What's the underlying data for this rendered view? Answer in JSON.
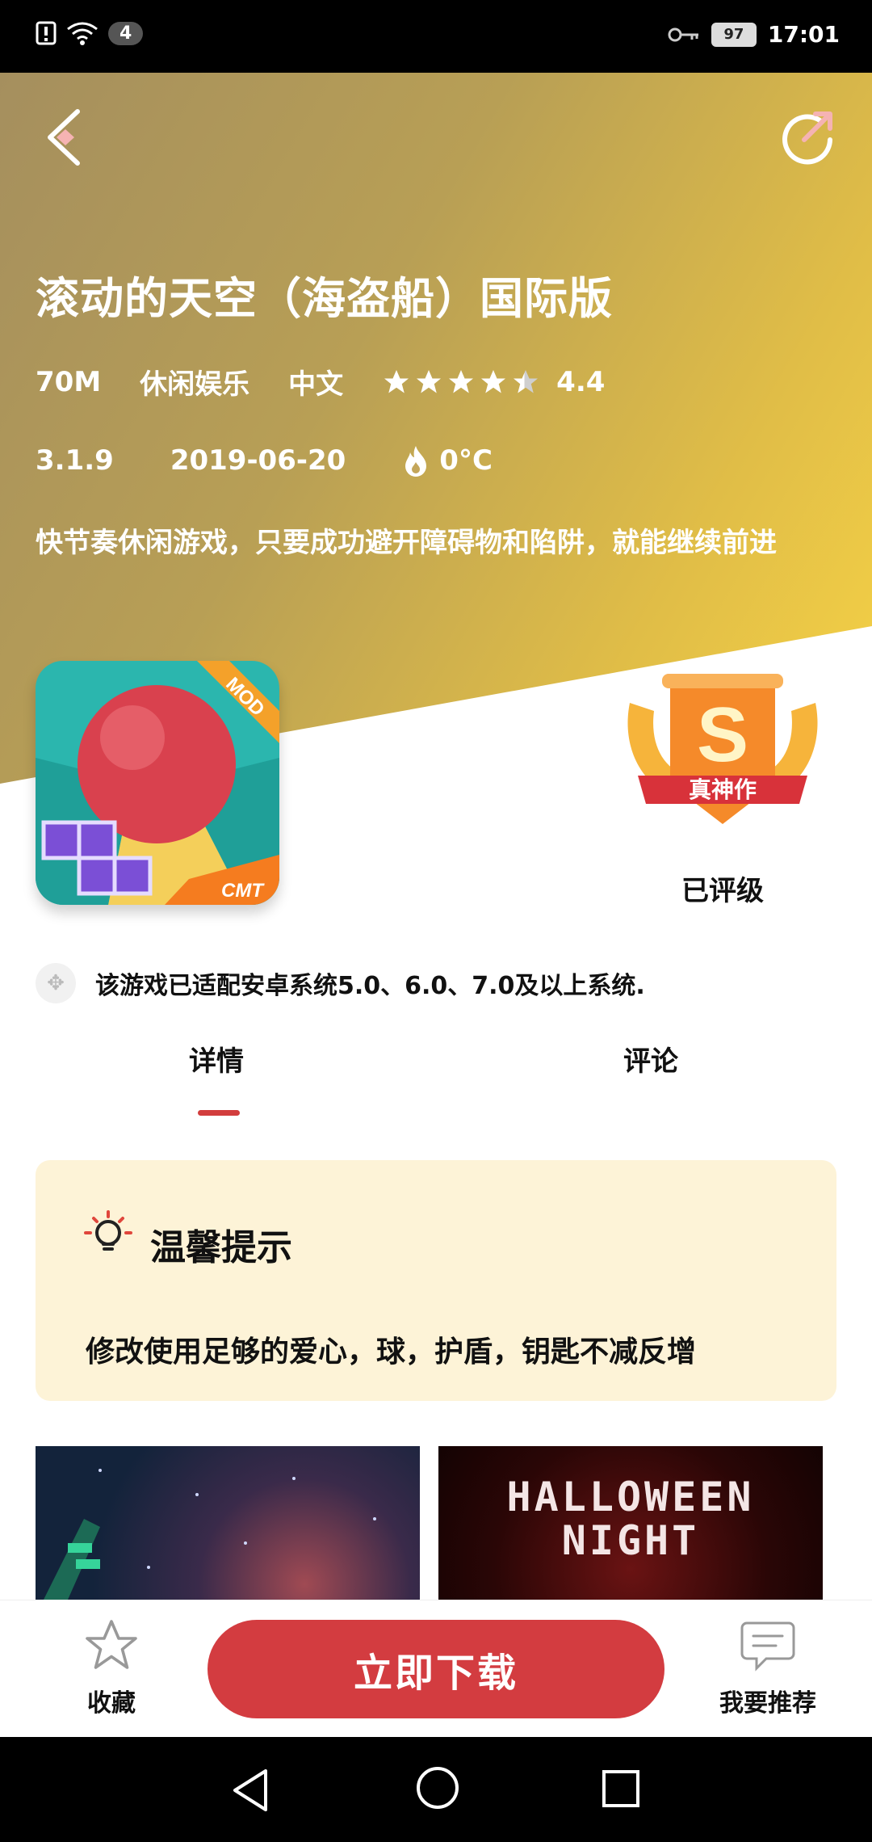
{
  "status_bar": {
    "notification_count": "4",
    "battery": "97",
    "time": "17:01"
  },
  "app": {
    "title": "滚动的天空（海盗船）国际版",
    "size": "70M",
    "category": "休闲娱乐",
    "language": "中文",
    "rating": "4.4",
    "rating_value": 4.4,
    "version": "3.1.9",
    "date": "2019-06-20",
    "temperature": "0°C",
    "description": "快节奏休闲游戏，只要成功避开障碍物和陷阱，就能继续前进",
    "icon_badge": "MOD",
    "icon_brand": "CMT"
  },
  "award": {
    "letter": "S",
    "ribbon": "真神作",
    "label": "已评级"
  },
  "compat_notice": "该游戏已适配安卓系统5.0、6.0、7.0及以上系统.",
  "tabs": [
    {
      "label": "详情"
    },
    {
      "label": "评论"
    }
  ],
  "tip": {
    "title": "温馨提示",
    "text": "修改使用足够的爱心，球，护盾，钥匙不减反增"
  },
  "screenshots": [
    {
      "text": ""
    },
    {
      "text": "HALLOWEEN NIGHT"
    }
  ],
  "bottom_bar": {
    "favorite": "收藏",
    "download": "立即下载",
    "recommend": "我要推荐"
  },
  "colors": {
    "accent": "#d33c40",
    "hero_start": "#a58f5e",
    "hero_end": "#f6d246",
    "tip_bg": "#fdf3d7"
  }
}
